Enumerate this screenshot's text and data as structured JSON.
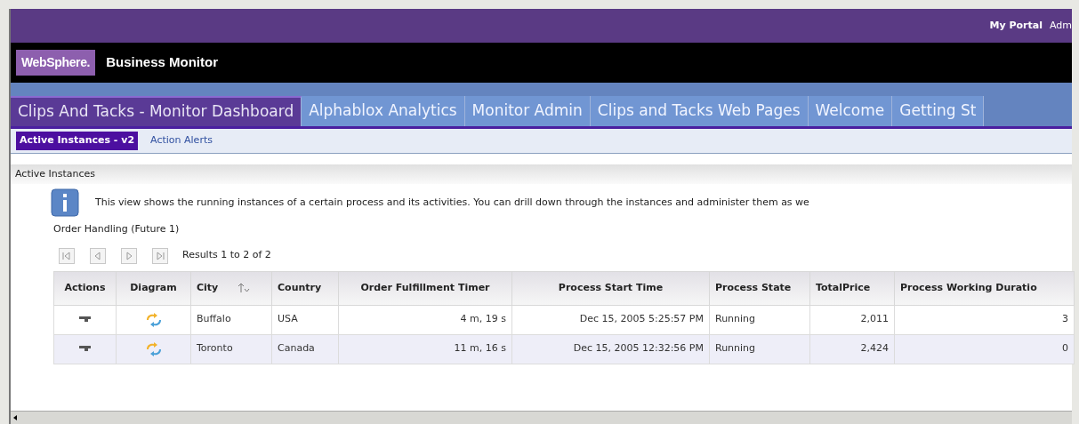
{
  "header": {
    "links": [
      {
        "label": "My Portal",
        "bold": true
      },
      {
        "label": "Adm",
        "bold": false
      }
    ],
    "brand": "WebSphere.",
    "product": "Business Monitor"
  },
  "tabs": [
    {
      "label": "Clips And Tacks - Monitor Dashboard",
      "selected": true
    },
    {
      "label": "Alphablox Analytics",
      "selected": false
    },
    {
      "label": "Monitor Admin",
      "selected": false
    },
    {
      "label": "Clips and Tacks Web Pages",
      "selected": false
    },
    {
      "label": "Welcome",
      "selected": false
    },
    {
      "label": "Getting St",
      "selected": false
    }
  ],
  "subtabs": [
    {
      "label": "Active Instances - v2",
      "selected": true
    },
    {
      "label": "Action Alerts",
      "selected": false
    }
  ],
  "panel": {
    "title": "Active Instances",
    "info": "This view shows the running instances of a certain process and its activities. You can drill down through the instances and administer them as we",
    "subtitle": "Order Handling (Future 1)",
    "results": "Results 1 to 2 of 2"
  },
  "table": {
    "columns": [
      {
        "label": "Actions",
        "sorted": false
      },
      {
        "label": "Diagram",
        "sorted": false
      },
      {
        "label": "City",
        "sorted": true
      },
      {
        "label": "Country",
        "sorted": false
      },
      {
        "label": "Order Fulfillment Timer",
        "sorted": false
      },
      {
        "label": "Process Start Time",
        "sorted": false
      },
      {
        "label": "Process State",
        "sorted": false
      },
      {
        "label": "TotalPrice",
        "sorted": false
      },
      {
        "label": "Process Working Duratio",
        "sorted": false
      }
    ],
    "rows": [
      {
        "city": "Buffalo",
        "country": "USA",
        "timer": "4 m, 19 s",
        "start": "Dec 15, 2005 5:25:57 PM",
        "state": "Running",
        "price": "2,011",
        "duration": "3"
      },
      {
        "city": "Toronto",
        "country": "Canada",
        "timer": "11 m, 16 s",
        "start": "Dec 15, 2005 12:32:56 PM",
        "state": "Running",
        "price": "2,424",
        "duration": "0"
      }
    ]
  }
}
